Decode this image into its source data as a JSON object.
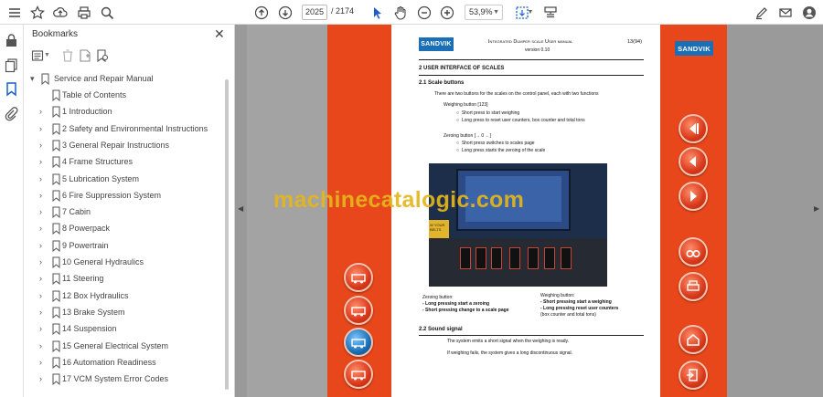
{
  "toolbar": {
    "page_current": "2025",
    "page_total": "/ 2174",
    "zoom": "53,9%"
  },
  "bookmarks": {
    "title": "Bookmarks",
    "root": "Service and Repair Manual",
    "items": [
      "Table of Contents",
      "1 Introduction",
      "2 Safety and Environmental Instructions",
      "3 General Repair Instructions",
      "4 Frame Structures",
      "5 Lubrication System",
      "6 Fire Suppression System",
      "7 Cabin",
      "8 Powerpack",
      "9 Powertrain",
      "10 General Hydraulics",
      "11 Steering",
      "12 Box Hydraulics",
      "13 Brake System",
      "14 Suspension",
      "15 General Electrical System",
      "16 Automation Readiness",
      "17 VCM System Error Codes"
    ]
  },
  "document": {
    "logo": "SANDVIK",
    "header_title": "Integrated Dumper scale User manual",
    "header_version": "version 0.10",
    "page_number": "13(94)",
    "section": "2 USER INTERFACE OF SCALES",
    "sub1": "2.1 Scale buttons",
    "intro": "There are two buttons for the scales on the control panel, each with two functions",
    "weighing_button": "Weighing button [123]",
    "weighing_short": "Short press to start weighing",
    "weighing_long": "Long press to reset user counters, box counter and total tons",
    "zeroing_button": "Zeroing button [→ 0 ←]",
    "zeroing_short": "Short press switches to scales page",
    "zeroing_long": "Long press starts the zeroing of the scale",
    "cap_zero_title": "Zeroing button:",
    "cap_zero_1": "- Long pressing start a zeroing",
    "cap_zero_2": "- Short pressing change to a scale page",
    "cap_weigh_title": "Weighing button:",
    "cap_weigh_1": "- Short pressing start a weighing",
    "cap_weigh_2": "- Long pressing reset user counters",
    "cap_weigh_3": "(box counter and total tons)",
    "photo_sticker": "W YOUR BELTS",
    "sub2": "2.2 Sound signal",
    "sound_1": "The system emits a short signal when the weighing is ready.",
    "sound_2": "If weighing fails, the system gives a long discontinuous signal."
  },
  "watermark": "machinecatalogic.com",
  "colors": {
    "orange": "#e8471b",
    "brand_blue": "#1a6fb6",
    "watermark": "#e5b61d"
  }
}
